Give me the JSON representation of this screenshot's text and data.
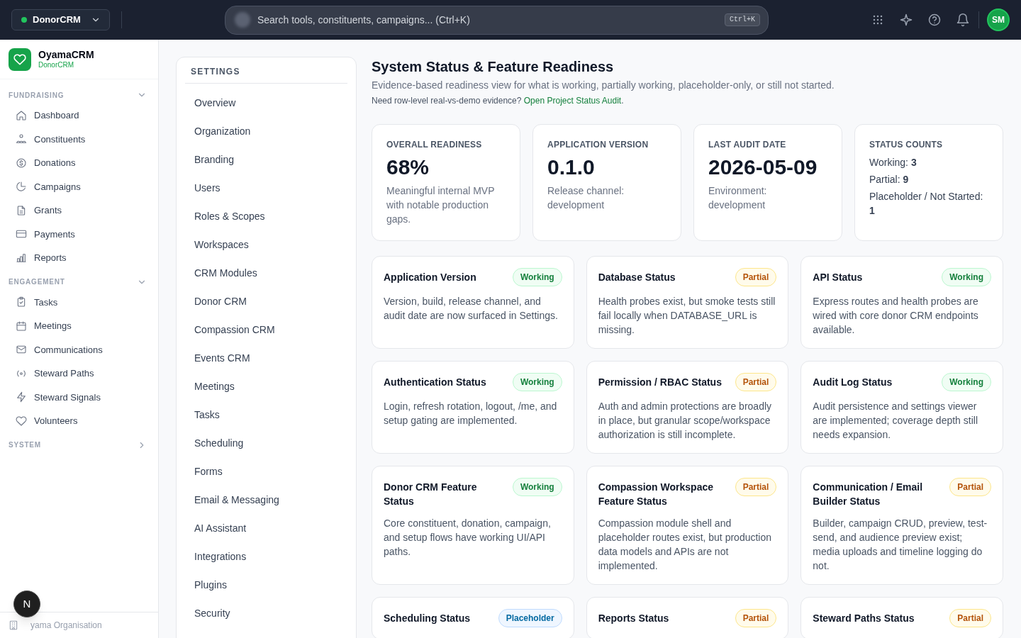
{
  "top_bar": {
    "workspace_switcher": {
      "label": "DonorCRM"
    },
    "search": {
      "placeholder": "Search tools, constituents, campaigns... (Ctrl+K)",
      "shortcut": "Ctrl+K"
    },
    "avatar": {
      "initials": "SM"
    }
  },
  "sidebar": {
    "brand": {
      "name": "OyamaCRM",
      "product": "DonorCRM"
    },
    "sections": [
      {
        "heading": "FUNDRAISING",
        "expanded": true,
        "items": [
          "Dashboard",
          "Constituents",
          "Donations",
          "Campaigns",
          "Grants",
          "Payments",
          "Reports"
        ]
      },
      {
        "heading": "ENGAGEMENT",
        "expanded": true,
        "items": [
          "Tasks",
          "Meetings",
          "Communications",
          "Steward Paths",
          "Steward Signals",
          "Volunteers"
        ]
      },
      {
        "heading": "SYSTEM",
        "expanded": false
      }
    ],
    "footer": {
      "organisation": "yama Organisation"
    }
  },
  "dev_tools_button": {
    "label": "N"
  },
  "settings_nav": {
    "heading": "SETTINGS",
    "items": [
      "Overview",
      "Organization",
      "Branding",
      "Users",
      "Roles & Scopes",
      "Workspaces",
      "CRM Modules",
      "Donor CRM",
      "Compassion CRM",
      "Events CRM",
      "Meetings",
      "Tasks",
      "Scheduling",
      "Forms",
      "Email & Messaging",
      "AI Assistant",
      "Integrations",
      "Plugins",
      "Security"
    ]
  },
  "page": {
    "title": "System Status & Feature Readiness",
    "subtitle": "Evidence-based readiness view for what is working, partially working, placeholder-only, or still not started.",
    "audit_note": {
      "text": "Need row-level real-vs-demo evidence?",
      "link": "Open Project Status Audit",
      "end": "."
    }
  },
  "stat_cards": [
    {
      "kind": "metric",
      "label": "OVERALL READINESS",
      "value": "68%",
      "description": "Meaningful internal MVP with notable production gaps."
    },
    {
      "kind": "metric",
      "label": "APPLICATION VERSION",
      "value": "0.1.0",
      "description": "Release channel: development"
    },
    {
      "kind": "metric",
      "label": "LAST AUDIT DATE",
      "value": "2026-05-09",
      "description": "Environment: development"
    },
    {
      "kind": "counts",
      "label": "STATUS COUNTS",
      "counts": [
        "Working: **3**",
        "Partial: **9**",
        "Placeholder / Not Started: **1**"
      ]
    }
  ],
  "status_cards": [
    {
      "title": "Application Version",
      "badge": {
        "kind": "working",
        "label": "Working"
      },
      "description": "Version, build, release channel, and audit date are now surfaced in Settings."
    },
    {
      "title": "Database Status",
      "badge": {
        "kind": "partial",
        "label": "Partial"
      },
      "description": "Health probes exist, but smoke tests still fail locally when DATABASE_URL is missing."
    },
    {
      "title": "API Status",
      "badge": {
        "kind": "working",
        "label": "Working"
      },
      "description": "Express routes and health probes are wired with core donor CRM endpoints available."
    },
    {
      "title": "Authentication Status",
      "badge": {
        "kind": "working",
        "label": "Working"
      },
      "description": "Login, refresh rotation, logout, /me, and setup gating are implemented."
    },
    {
      "title": "Permission / RBAC Status",
      "badge": {
        "kind": "partial",
        "label": "Partial"
      },
      "description": "Auth and admin protections are broadly in place, but granular scope/workspace authorization is still incomplete."
    },
    {
      "title": "Audit Log Status",
      "badge": {
        "kind": "working",
        "label": "Working"
      },
      "description": "Audit persistence and settings viewer are implemented; coverage depth still needs expansion."
    },
    {
      "title": "Donor CRM Feature Status",
      "badge": {
        "kind": "working",
        "label": "Working"
      },
      "description": "Core constituent, donation, campaign, and setup flows have working UI/API paths."
    },
    {
      "title": "Compassion Workspace Feature Status",
      "badge": {
        "kind": "partial",
        "label": "Partial"
      },
      "description": "Compassion module shell and placeholder routes exist, but production data models and APIs are not implemented."
    },
    {
      "title": "Communication / Email Builder Status",
      "badge": {
        "kind": "partial",
        "label": "Partial"
      },
      "description": "Builder, campaign CRUD, preview, test-send, and audience preview exist; media uploads and timeline logging do not."
    },
    {
      "title": "Scheduling Status",
      "badge": {
        "kind": "placeholder",
        "label": "Placeholder"
      }
    },
    {
      "title": "Reports Status",
      "badge": {
        "kind": "partial",
        "label": "Partial"
      }
    },
    {
      "title": "Steward Paths Status",
      "badge": {
        "kind": "partial",
        "label": "Partial"
      }
    }
  ]
}
